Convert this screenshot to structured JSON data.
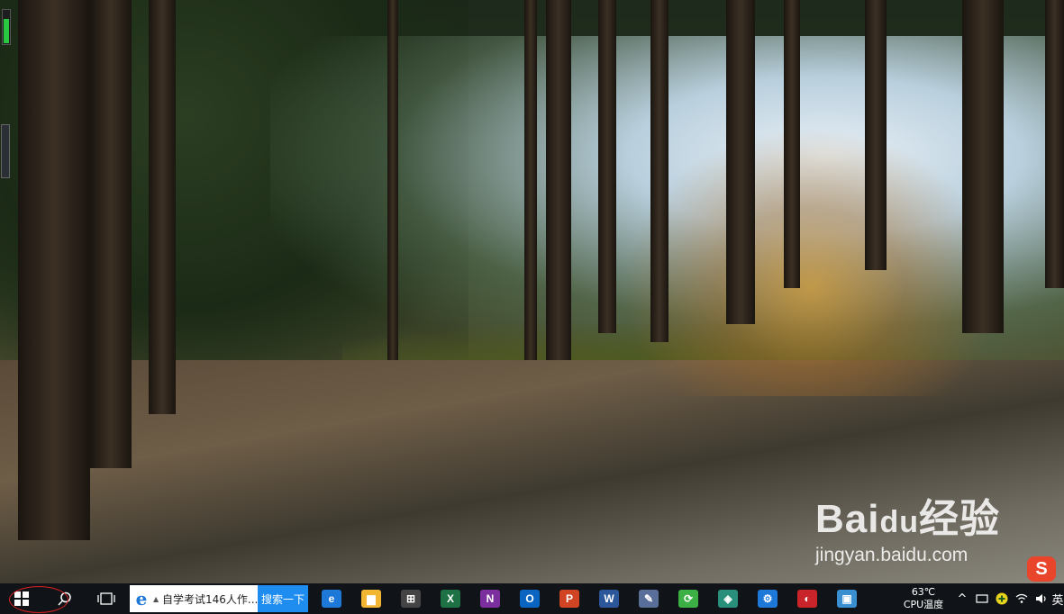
{
  "desktop": {
    "watermark": {
      "brand": "Bai",
      "brand_mark": "du",
      "brand_suffix": "经验",
      "url": "jingyan.baidu.com"
    },
    "sogou_label": "S"
  },
  "taskbar": {
    "ie_search": {
      "query": "自学考试146人作...",
      "button": "搜索一下"
    },
    "apps": [
      {
        "name": "edge",
        "letter": "e",
        "color": "#1e78d8"
      },
      {
        "name": "file-explorer",
        "letter": "▆",
        "color": "#f2b632"
      },
      {
        "name": "store",
        "letter": "⊞",
        "color": "#444444"
      },
      {
        "name": "excel",
        "letter": "X",
        "color": "#1e7145"
      },
      {
        "name": "onenote",
        "letter": "N",
        "color": "#7b2f9e"
      },
      {
        "name": "outlook",
        "letter": "O",
        "color": "#0a64c2"
      },
      {
        "name": "powerpoint",
        "letter": "P",
        "color": "#d04423"
      },
      {
        "name": "word",
        "letter": "W",
        "color": "#2b579a"
      },
      {
        "name": "paint",
        "letter": "✎",
        "color": "#5a6e9a"
      },
      {
        "name": "green-app",
        "letter": "⟳",
        "color": "#3cb044"
      },
      {
        "name": "photos",
        "letter": "◈",
        "color": "#2a8f7a"
      },
      {
        "name": "settings",
        "letter": "⚙",
        "color": "#1e78d8"
      },
      {
        "name": "red-app",
        "letter": "◐",
        "color": "#c8242a"
      },
      {
        "name": "screen-app",
        "letter": "▣",
        "color": "#3a8fd0"
      }
    ],
    "tray": {
      "temp_value": "63℃",
      "temp_label": "CPU温度"
    }
  }
}
